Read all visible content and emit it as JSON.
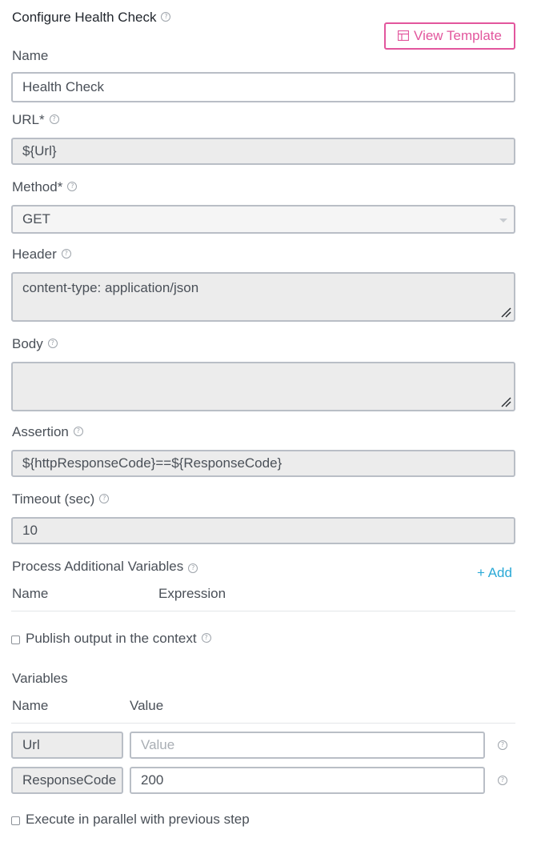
{
  "header": {
    "title": "Configure Health Check",
    "view_template_label": "View Template"
  },
  "fields": {
    "name": {
      "label": "Name",
      "value": "Health Check"
    },
    "url": {
      "label": "URL*",
      "value": "${Url}"
    },
    "method": {
      "label": "Method*",
      "value": "GET"
    },
    "header": {
      "label": "Header",
      "value": "content-type: application/json"
    },
    "body": {
      "label": "Body",
      "value": ""
    },
    "assertion": {
      "label": "Assertion",
      "value": "${httpResponseCode}==${ResponseCode}"
    },
    "timeout": {
      "label": "Timeout (sec)",
      "value": "10"
    }
  },
  "additional_variables": {
    "label": "Process Additional Variables",
    "add_label": "+ Add",
    "columns": [
      "Name",
      "Expression"
    ]
  },
  "publish_output": {
    "label": "Publish output in the context",
    "checked": false
  },
  "variables": {
    "label": "Variables",
    "columns": [
      "Name",
      "Value"
    ],
    "rows": [
      {
        "name": "Url",
        "value": "",
        "placeholder": "Value"
      },
      {
        "name": "ResponseCode",
        "value": "200",
        "placeholder": "Value"
      }
    ]
  },
  "execute_parallel": {
    "label": "Execute in parallel with previous step",
    "checked": false
  },
  "colors": {
    "accent": "#e2569d",
    "link": "#2aa9d6",
    "field_bg": "#ececec",
    "border": "#b9bec6"
  },
  "icons": {
    "help": "question-circle-icon",
    "template": "table-icon",
    "dropdown": "caret-down-icon",
    "resize": "resize-grip-icon"
  }
}
